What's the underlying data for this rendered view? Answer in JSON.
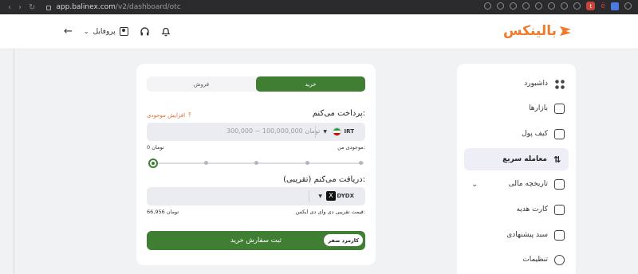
{
  "browser": {
    "url_domain": "app.balinex.com",
    "url_path": "/v2/dashboard/otc",
    "ext_letter": "t",
    "ext_mark": "ë"
  },
  "header": {
    "logo_text": "بالینکس",
    "profile_label": "پروفایل"
  },
  "sidebar": {
    "items": [
      {
        "label": "داشبورد",
        "icon": "dashboard-icon"
      },
      {
        "label": "بازارها",
        "icon": "markets-icon"
      },
      {
        "label": "کیف پول",
        "icon": "wallet-icon"
      },
      {
        "label": "معامله سریع",
        "icon": "swap-icon",
        "active": true
      },
      {
        "label": "تاریخچه مالی",
        "icon": "history-icon",
        "expandable": true
      },
      {
        "label": "کارت هدیه",
        "icon": "gift-icon"
      },
      {
        "label": "سبد پیشنهادی",
        "icon": "basket-icon"
      },
      {
        "label": "تنظیمات",
        "icon": "settings-icon"
      }
    ]
  },
  "trade": {
    "tab_buy": "خرید",
    "tab_sell": "فروش",
    "pay_label": "پرداخت می‌کنم:",
    "increase_balance": "افزایش موجودی",
    "pay_placeholder": "300,000 ~ 100,000,000 تومان",
    "pay_currency": "IRT",
    "balance_label": "موجودی من:",
    "balance_value": "0 تومان",
    "slider_percent": 0,
    "receive_label": "دریافت می‌کنم (تقریبی):",
    "receive_currency": "DYDX",
    "price_label": "قیمت تقریبی دی وای دی ایکس:",
    "price_value": "66,956 تومان",
    "submit_label": "ثبت سفارش خرید",
    "fee_badge": "کارمزد صفر"
  },
  "colors": {
    "brand_orange": "#f07b2c",
    "primary_green": "#3f7e33"
  }
}
